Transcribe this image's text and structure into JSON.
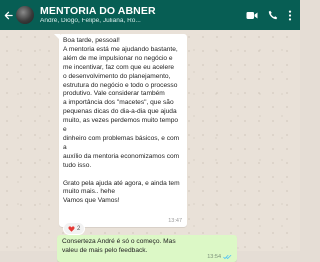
{
  "header": {
    "title": "MENTORIA DO ABNER",
    "members": "André, Diogo, Felipe, Juliana, Ro..."
  },
  "messages": [
    {
      "direction": "in",
      "text": "Boa tarde, pessoal!\nA mentoria está me ajudando bastante,\nalém de me impulsionar no negócio e\nme incentivar, faz com que eu acelere\no desenvolvimento do planejamento,\nestrutura do negócio e todo o processo\nprodutivo. Vale considerar também\na importância dos \"macetes\", que são\npequenas dicas do dia-a-dia que ajuda\nmuito, as vezes perdemos muito tempo e\ndinheiro com problemas básicos, e com a\nauxílio da mentoria economizamos com\ntudo isso.\n\nGrato pela ajuda até agora, e ainda tem\nmuito mais.. hehe\nVamos que Vamos!",
      "time": "13:47",
      "reaction": {
        "emoji_icon": "heart-emoji-icon",
        "count": "2"
      }
    },
    {
      "direction": "out",
      "text": "Conserteza André é só o começo.  Mas\nvaleu de mais pelo feedback.",
      "time": "13:54",
      "status_icon": "double-check-icon"
    }
  ],
  "colors": {
    "header_bg": "#075e54",
    "chat_bg": "#e9e1d8",
    "incoming_bubble": "#ffffff",
    "outgoing_bubble": "#dcf8c6",
    "read_ticks": "#4fc3f7",
    "heart": "#e53935"
  }
}
